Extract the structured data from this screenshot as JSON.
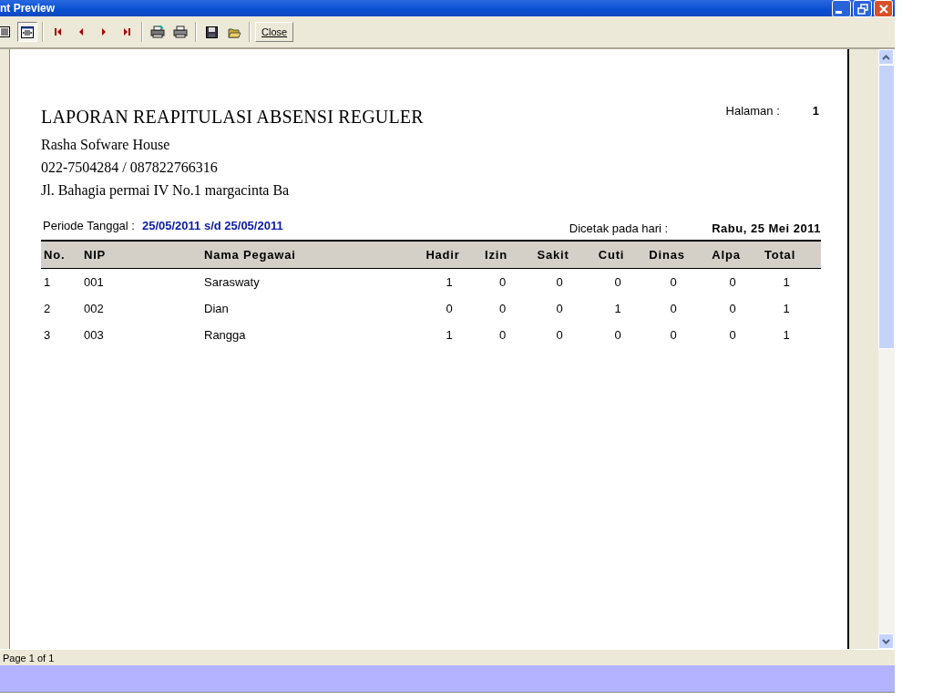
{
  "window": {
    "title": "nt Preview"
  },
  "toolbar": {
    "close_button": "Close"
  },
  "report": {
    "title": "LAPORAN REAPITULASI ABSENSI REGULER",
    "company_lines": [
      "Rasha Sofware House",
      "022-7504284 / 087822766316",
      "Jl. Bahagia permai IV No.1 margacinta Ba"
    ],
    "page_label": "Halaman :",
    "page_number": "1",
    "period_label": "Periode Tanggal :",
    "period_value": "25/05/2011 s/d 25/05/2011",
    "printed_label": "Dicetak pada hari :",
    "printed_value": "Rabu,  25 Mei 2011",
    "columns": [
      "No.",
      "NIP",
      "Nama Pegawai",
      "Hadir",
      "Izin",
      "Sakit",
      "Cuti",
      "Dinas",
      "Alpa",
      "Total"
    ],
    "rows": [
      [
        "1",
        "001",
        "Saraswaty",
        "1",
        "0",
        "0",
        "0",
        "0",
        "0",
        "1"
      ],
      [
        "2",
        "002",
        "Dian",
        "0",
        "0",
        "0",
        "1",
        "0",
        "0",
        "1"
      ],
      [
        "3",
        "003",
        "Rangga",
        "1",
        "0",
        "0",
        "0",
        "0",
        "0",
        "1"
      ]
    ]
  },
  "status_bar": "Page 1 of 1"
}
